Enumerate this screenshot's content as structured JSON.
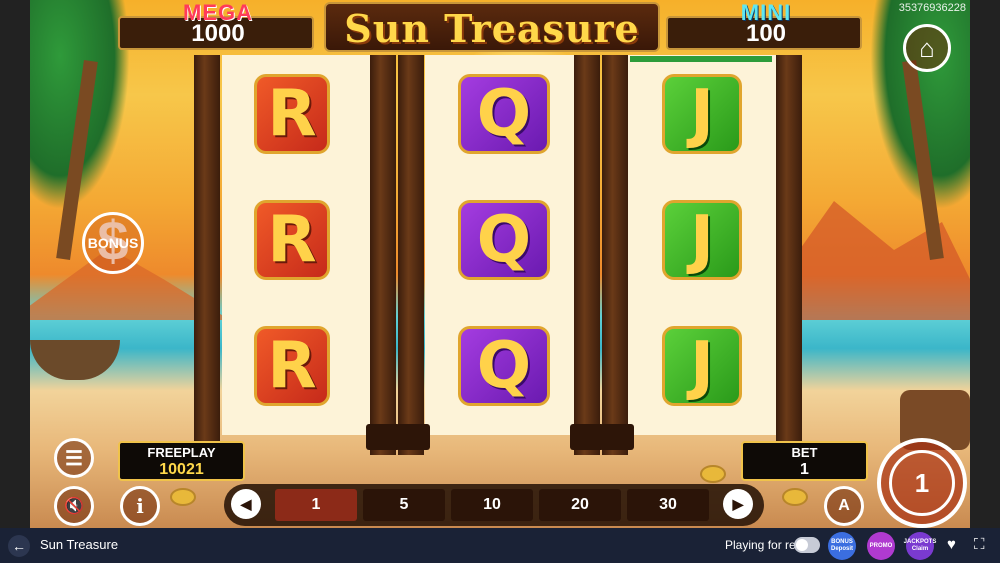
{
  "game": {
    "title": "Sun Treasure",
    "session_id": "35376936228",
    "jackpots": [
      {
        "label": "MEGA",
        "value": "1000",
        "color": "#ff3b5a"
      },
      {
        "label": "MINI",
        "value": "100",
        "color": "#5ee6f2"
      }
    ],
    "reels": [
      {
        "symbols": [
          "R",
          "R",
          "R"
        ],
        "color": "red"
      },
      {
        "symbols": [
          "Q",
          "Q",
          "Q"
        ],
        "color": "purple"
      },
      {
        "symbols": [
          "J",
          "J",
          "J"
        ],
        "color": "green"
      }
    ],
    "bonus_label": "BONUS",
    "freeplay": {
      "label": "FREEPLAY",
      "value": "10021"
    },
    "bet": {
      "label": "BET",
      "value": "1"
    },
    "bet_options": [
      "1",
      "5",
      "10",
      "20",
      "30"
    ],
    "selected_bet": "1",
    "auto_label": "A",
    "spin_label": "1"
  },
  "footer": {
    "title": "Sun Treasure",
    "playing_label": "Playing for real",
    "promos": [
      {
        "label": "BONUS Deposit",
        "color": "#3b6ee0"
      },
      {
        "label": "PROMO",
        "color": "#b03ad0"
      },
      {
        "label": "JACKPOTS Claim",
        "color": "#7a3ad0"
      }
    ]
  },
  "icons": [
    "home-icon",
    "menu-icon",
    "sound-off-icon",
    "info-icon",
    "back-arrow-icon",
    "heart-icon",
    "fullscreen-icon"
  ]
}
